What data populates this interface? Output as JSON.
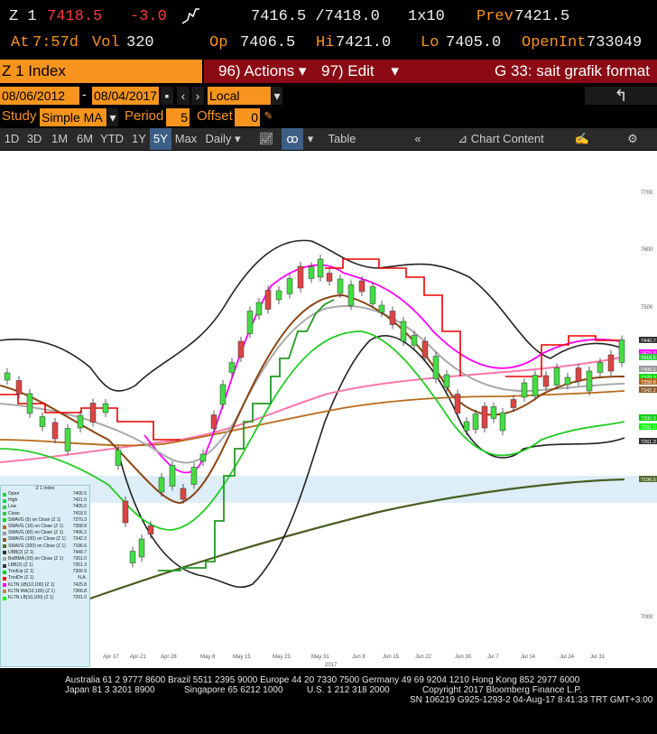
{
  "quote": {
    "ticker": "Z 1",
    "last": "7418.5",
    "change": "-3.0",
    "bid_ask": "7416.5 /7418.0",
    "size": "1x10",
    "prev_label": "Prev",
    "prev_value": "7421.5",
    "at_label": "At",
    "time": "7:57d",
    "vol_label": "Vol",
    "vol_value": "320",
    "op_label": "Op",
    "op_value": "7406.5",
    "hi_label": "Hi",
    "hi_value": "7421.0",
    "lo_label": "Lo",
    "lo_value": "7405.0",
    "oi_label": "OpenInt",
    "oi_value": "733049"
  },
  "header": {
    "security": "Z 1 Index",
    "actions": "96) Actions",
    "edit": "97) Edit",
    "page_title": "G 33: sait grafik format"
  },
  "controls": {
    "start_date": "08/06/2012",
    "dash": "-",
    "end_date": "08/04/2017",
    "currency": "Local CCY",
    "study_label": "Study",
    "study_value": "Simple MA",
    "period_label": "Period",
    "period_value": "5",
    "offset_label": "Offset",
    "offset_value": "0"
  },
  "toolbar": {
    "ranges": [
      "1D",
      "3D",
      "1M",
      "6M",
      "YTD",
      "1Y",
      "5Y",
      "Max"
    ],
    "selected_range": "5Y",
    "frequency": "Daily",
    "table": "Table",
    "chart_content": "Chart Content"
  },
  "colors": {
    "orange": "#f7941d",
    "red_bar": "#8b0a14",
    "selected_tab": "#3c5f87",
    "chart_bg": "#ffffff",
    "legend_bg": "#d9eef7"
  },
  "legend": {
    "title": "Z 1 Index",
    "items": [
      {
        "label": "Open",
        "value": "7406.5",
        "color": "#2ecc40"
      },
      {
        "label": "High",
        "value": "7421.0",
        "color": "#2ecc40"
      },
      {
        "label": "Low",
        "value": "7405.0",
        "color": "#2ecc40"
      },
      {
        "label": "Close",
        "value": "7418.5",
        "color": "#2ecc40"
      },
      {
        "label": "SMAVG (5) on Close (Z 1)",
        "value": "7370.3",
        "color": "#00dd00"
      },
      {
        "label": "SMAVG (10) on Close (Z 1)",
        "value": "7358.8",
        "color": "#b5651d"
      },
      {
        "label": "SMAVG (60) on Close (Z 1)",
        "value": "7406.2",
        "color": "#999999"
      },
      {
        "label": "SMAVG (100) on Close (Z 1)",
        "value": "7342.2",
        "color": "#8b5a2b"
      },
      {
        "label": "SMAVG (200) on Close (Z 1)",
        "value": "7196.6",
        "color": "#556b2f"
      },
      {
        "label": "UBB(2) (Z 1)",
        "value": "7440.7",
        "color": "#333333"
      },
      {
        "label": "BolBMA (20) on Close (Z 1)",
        "value": "7351.0",
        "color": "#aaaaaa"
      },
      {
        "label": "LBB(2) (Z 1)",
        "value": "7261.3",
        "color": "#333333"
      },
      {
        "label": "TrndUp (Z 1)",
        "value": "7300.9",
        "color": "#00cc00"
      },
      {
        "label": "TrndDn (Z 1)",
        "value": "N.A.",
        "color": "#ff0000"
      },
      {
        "label": "KLTN UB(10,100) (Z 1)",
        "value": "7425.8",
        "color": "#ff00ff"
      },
      {
        "label": "KLTN MA(10,100) (Z 1)",
        "value": "7366.8",
        "color": "#cc8844"
      },
      {
        "label": "KLTN LB(10,100) (Z 1)",
        "value": "7291.0",
        "color": "#00ff00"
      }
    ]
  },
  "chart": {
    "x_labels": [
      "Mar 31",
      "Apr 7",
      "Apr 17",
      "Apr 21",
      "Apr 28",
      "May 8",
      "May 15",
      "May 23",
      "May 31",
      "Jun 8",
      "Jun 15",
      "Jun 22",
      "Jun 30",
      "Jul 7",
      "Jul 14",
      "Jul 24",
      "Jul 31"
    ],
    "year_label": "2017",
    "y_labels": [
      "7700",
      "7600",
      "7500",
      "7000"
    ],
    "right_tags": [
      {
        "text": "7440.7",
        "bg": "#333333"
      },
      {
        "text": "7425.8",
        "bg": "#ff00ff"
      },
      {
        "text": "7418.5",
        "bg": "#2ecc40"
      },
      {
        "text": "7406.2",
        "bg": "#999999"
      },
      {
        "text": "7370.3",
        "bg": "#00dd00"
      },
      {
        "text": "7358.8",
        "bg": "#b5651d"
      },
      {
        "text": "7342.2",
        "bg": "#8b5a2b"
      },
      {
        "text": "7300.9",
        "bg": "#00cc00"
      },
      {
        "text": "7291.0",
        "bg": "#00ff00"
      },
      {
        "text": "7261.3",
        "bg": "#333333"
      },
      {
        "text": "7196.6",
        "bg": "#556b2f"
      }
    ]
  },
  "footer": {
    "line1": "Australia 61 2 9777 8600 Brazil 5511 2395 9000 Europe 44 20 7330 7500 Germany 49 69 9204 1210 Hong Kong 852 2977 6000",
    "line2a": "Japan 81 3 3201 8900",
    "line2b": "Singapore 65 6212 1000",
    "line2c": "U.S. 1 212 318 2000",
    "line2d": "Copyright 2017 Bloomberg Finance L.P.",
    "line3": "SN 106219 G925-1293-2 04-Aug-17  8:41:33 TRT  GMT+3:00"
  }
}
